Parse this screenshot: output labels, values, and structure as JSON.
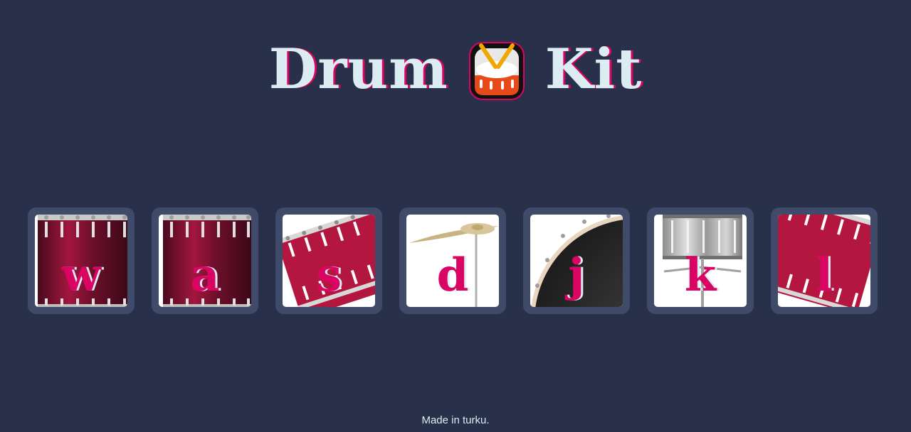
{
  "title": {
    "word1": "Drum",
    "icon": "drum-emoji-icon",
    "word2": "Kit"
  },
  "keys": [
    {
      "letter": "w",
      "sound": "tom",
      "art": "tall-tom-drum-icon"
    },
    {
      "letter": "a",
      "sound": "tom",
      "art": "tall-tom-drum-icon"
    },
    {
      "letter": "s",
      "sound": "tilted tom",
      "art": "tilted-tom-drum-icon"
    },
    {
      "letter": "d",
      "sound": "cymbal",
      "art": "cymbal-icon"
    },
    {
      "letter": "j",
      "sound": "bass drum",
      "art": "bass-drum-icon"
    },
    {
      "letter": "k",
      "sound": "snare",
      "art": "snare-drum-icon"
    },
    {
      "letter": "l",
      "sound": "tilted tom",
      "art": "tilted-tom-drum-icon"
    }
  ],
  "footer": {
    "text": "Made in turku."
  },
  "colors": {
    "background": "#283149",
    "key_frame": "#404b69",
    "accent": "#da0463",
    "light_text": "#dbedf3",
    "drum_red": "#a3163f"
  }
}
